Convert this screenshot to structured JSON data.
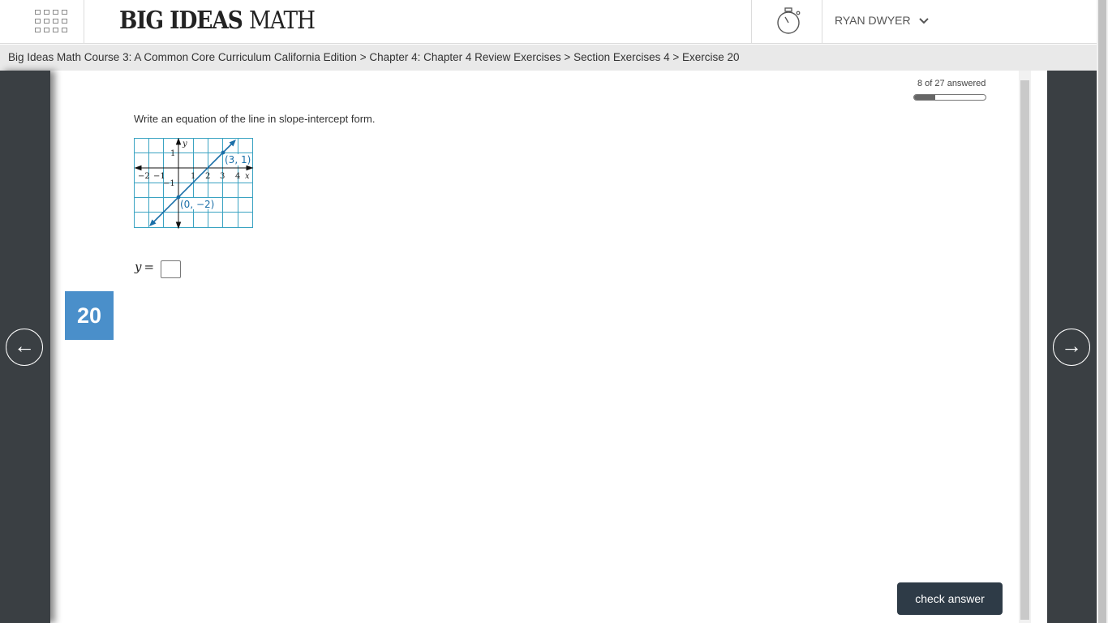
{
  "header": {
    "logo_bold": "BIG IDEAS",
    "logo_thin": "MATH",
    "user_name": "RYAN DWYER",
    "apps_icon": "grid-icon",
    "timer_icon": "stopwatch-icon",
    "user_chevron_icon": "chevron-down-icon"
  },
  "breadcrumb": {
    "text": "Big Ideas Math Course 3: A Common Core Curriculum California Edition > Chapter 4: Chapter 4 Review Exercises > Section Exercises 4 > Exercise 20"
  },
  "progress": {
    "text": "8 of 27 answered",
    "answered": 8,
    "total": 27
  },
  "question": {
    "number": "20",
    "prompt": "Write an equation of the line in slope-intercept form.",
    "answer_label": "y",
    "answer_equals": "=",
    "answer_value": ""
  },
  "graph": {
    "point_a_label": "(3, 1)",
    "point_b_label": "(0, −2)",
    "x_axis_label": "x",
    "y_axis_label": "y",
    "x_ticks": [
      "−2",
      "−1",
      "1",
      "2",
      "3",
      "4"
    ],
    "y_ticks": [
      "1",
      "−1"
    ],
    "line_color": "#1b6fa8",
    "grid_color": "#3aa3c2"
  },
  "nav": {
    "prev_icon": "arrow-left-icon",
    "next_icon": "arrow-right-icon",
    "prev_glyph": "←",
    "next_glyph": "→"
  },
  "actions": {
    "check_answer_label": "check answer"
  },
  "colors": {
    "side_panel": "#3a3f43",
    "question_badge": "#4a8fca",
    "check_button": "#2e3b47"
  }
}
